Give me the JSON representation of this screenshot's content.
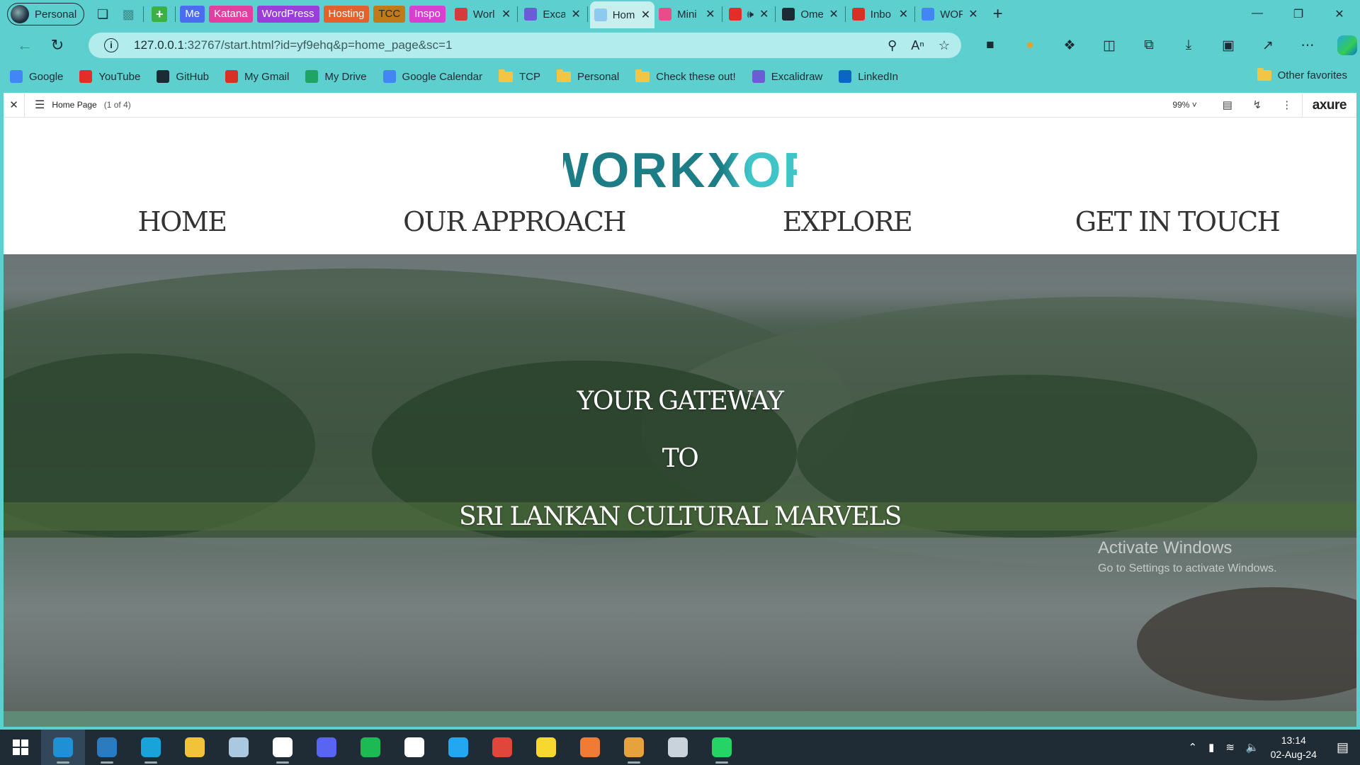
{
  "browser": {
    "profile_label": "Personal",
    "group_tabs": [
      {
        "label": "Me",
        "color": "#4c6cf0",
        "text_color": "#ffffff"
      },
      {
        "label": "Katana",
        "color": "#e33fa0",
        "text_color": "#ffffff"
      },
      {
        "label": "WordPress",
        "color": "#9b3ddb",
        "text_color": "#ffffff"
      },
      {
        "label": "Hosting",
        "color": "#e2612d",
        "text_color": "#ffffff"
      },
      {
        "label": "TCC",
        "color": "#c07a1a",
        "text_color": "#1c2b33"
      },
      {
        "label": "Inspo",
        "color": "#d63fcf",
        "text_color": "#ffffff"
      }
    ],
    "tabs": [
      {
        "title": "Worl",
        "icon": "trello-icon",
        "color": "#d63b3b"
      },
      {
        "title": "Excal",
        "icon": "excalidraw-icon",
        "color": "#6b5cd6"
      },
      {
        "title": "Hom",
        "icon": "axure-page-icon",
        "color": "#8ec9f0",
        "active": true
      },
      {
        "title": "Mini",
        "icon": "dribbble-icon",
        "color": "#ea4c89"
      },
      {
        "title": "",
        "icon": "youtube-icon",
        "color": "#e52d27",
        "extra_icon": "speaker-icon"
      },
      {
        "title": "Ome",
        "icon": "github-icon",
        "color": "#1c2b33"
      },
      {
        "title": "Inbo",
        "icon": "gmail-icon",
        "color": "#d93025"
      },
      {
        "title": "WOF",
        "icon": "docs-icon",
        "color": "#4285f4"
      }
    ],
    "address": {
      "host": "127.0.0.1",
      "rest": ":32767/start.html?id=yf9ehq&p=home_page&sc=1"
    },
    "favorites": [
      {
        "label": "Google",
        "icon": "google-icon",
        "color": "#4285f4"
      },
      {
        "label": "YouTube",
        "icon": "youtube-icon",
        "color": "#e52d27"
      },
      {
        "label": "GitHub",
        "icon": "github-icon",
        "color": "#1c2b33"
      },
      {
        "label": "My Gmail",
        "icon": "gmail-icon",
        "color": "#d93025"
      },
      {
        "label": "My Drive",
        "icon": "drive-icon",
        "color": "#1fa463"
      },
      {
        "label": "Google Calendar",
        "icon": "calendar-icon",
        "color": "#4285f4"
      },
      {
        "label": "TCP",
        "icon": "folder-icon",
        "color": "#f1c545"
      },
      {
        "label": "Personal",
        "icon": "folder-icon",
        "color": "#f1c545"
      },
      {
        "label": "Check these out!",
        "icon": "folder-icon",
        "color": "#f1c545"
      },
      {
        "label": "Excalidraw",
        "icon": "excalidraw-icon",
        "color": "#6b5cd6"
      },
      {
        "label": "LinkedIn",
        "icon": "linkedin-icon",
        "color": "#0a66c2"
      }
    ],
    "other_favorites": "Other favorites"
  },
  "axure": {
    "page_title": "Home Page",
    "page_count": "(1 of 4)",
    "zoom": "99%",
    "brand": "axure"
  },
  "site": {
    "logo_text": "WORKXOP",
    "nav": [
      "HOME",
      "OUR APPROACH",
      "EXPLORE",
      "GET IN TOUCH"
    ],
    "hero_lines": [
      "YOUR GATEWAY",
      "TO",
      "SRI LANKAN CULTURAL MARVELS"
    ]
  },
  "watermark": {
    "title": "Activate Windows",
    "subtitle": "Go to Settings to activate Windows."
  },
  "taskbar": {
    "apps": [
      {
        "name": "edge-profile-icon",
        "color": "#1f8fd6",
        "active": true
      },
      {
        "name": "edge-dev-icon",
        "color": "#2a7bbf"
      },
      {
        "name": "edge-icon",
        "color": "#1aa3d9"
      },
      {
        "name": "file-explorer-icon",
        "color": "#f3c23b"
      },
      {
        "name": "notes-app-icon",
        "color": "#aac8e0"
      },
      {
        "name": "blank-document-icon",
        "color": "#ffffff"
      },
      {
        "name": "discord-icon",
        "color": "#5865f2"
      },
      {
        "name": "spotify-icon",
        "color": "#1db954"
      },
      {
        "name": "notion-icon",
        "color": "#ffffff"
      },
      {
        "name": "vscode-icon",
        "color": "#22a7f0"
      },
      {
        "name": "chrome-icon",
        "color": "#e0463c"
      },
      {
        "name": "sticky-notes-icon",
        "color": "#f7d82f"
      },
      {
        "name": "xampp-icon",
        "color": "#f07b34"
      },
      {
        "name": "git-icon",
        "color": "#e6a23c"
      },
      {
        "name": "remote-desktop-icon",
        "color": "#c9d3dc"
      },
      {
        "name": "whatsapp-icon",
        "color": "#25d366"
      }
    ],
    "time": "13:14",
    "date": "02-Aug-24"
  }
}
